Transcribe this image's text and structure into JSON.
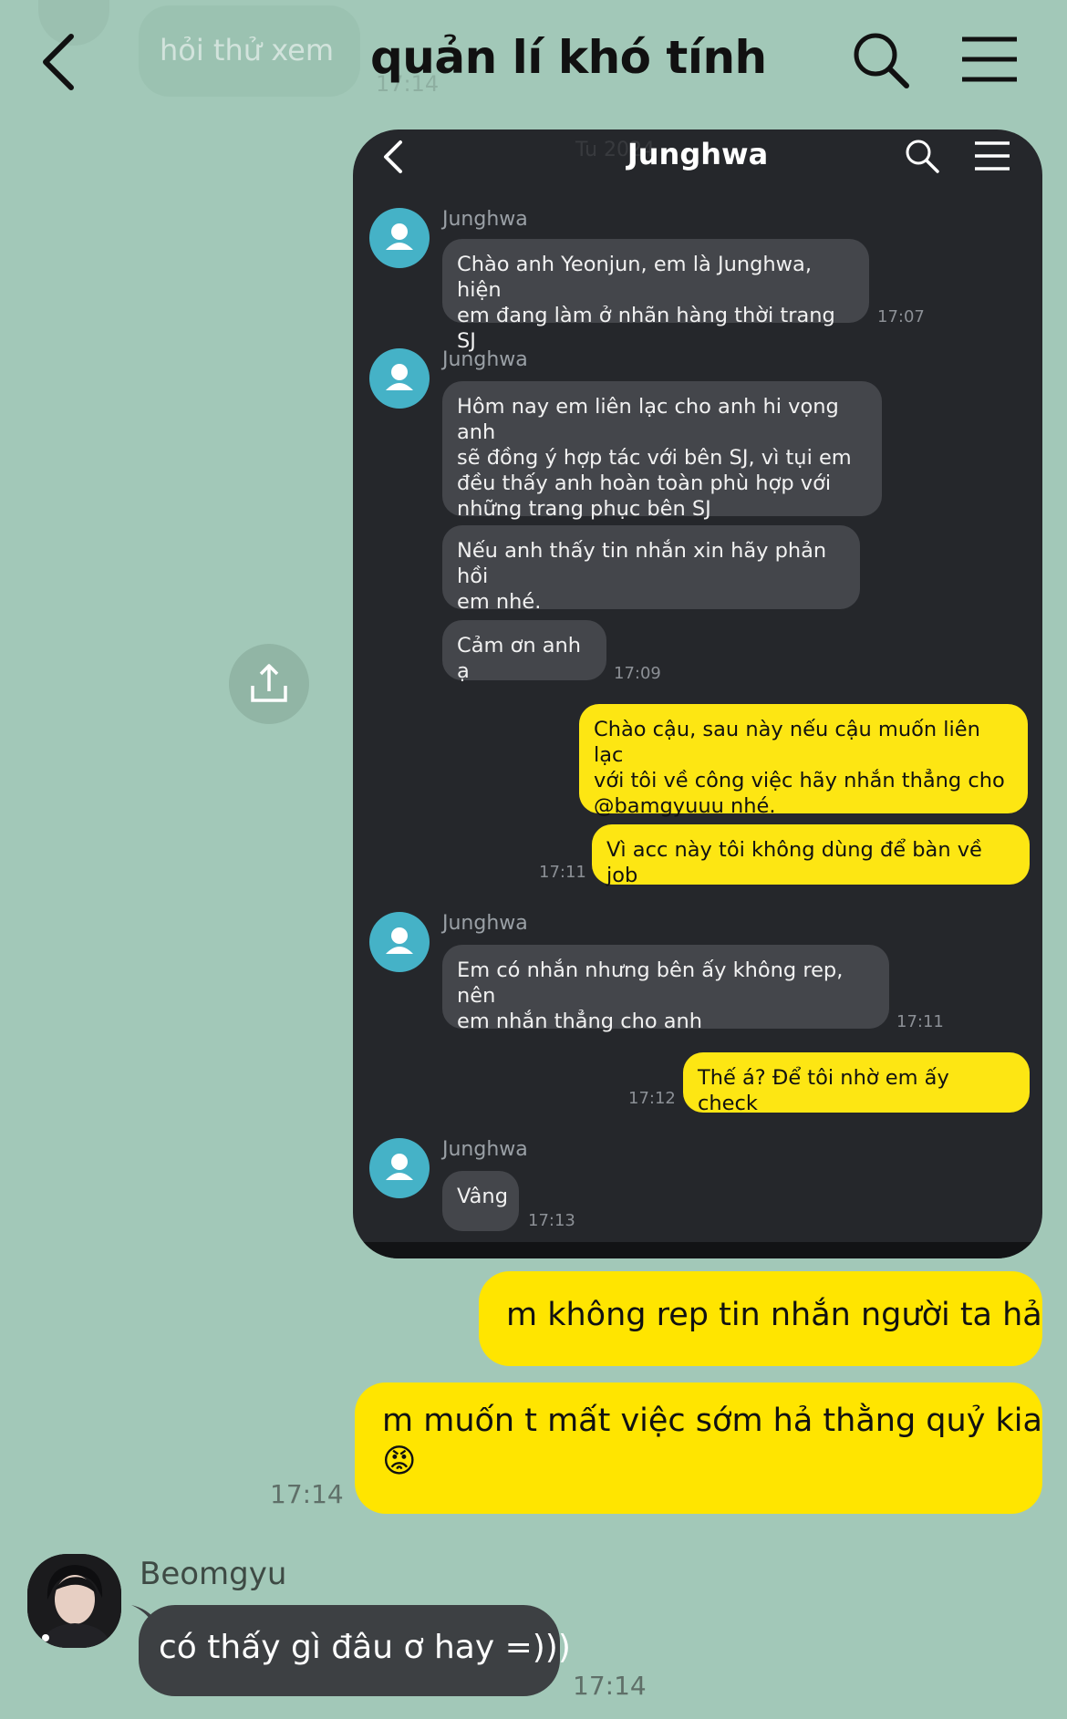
{
  "header": {
    "title": "quản lí khó tính",
    "back_icon": "chevron-left-icon",
    "search_icon": "search-icon",
    "menu_icon": "hamburger-menu-icon",
    "ghost_message": "hỏi thử xem",
    "ghost_time": "17:14"
  },
  "embedded": {
    "title": "Junghwa",
    "date_hint": "Tu                2024",
    "messages": [
      {
        "sender": "Junghwa",
        "lines": [
          "Chào anh Yeonjun, em là Junghwa, hiện",
          "em đang làm ở nhãn hàng thời trang SJ"
        ],
        "time": "17:07"
      },
      {
        "sender": "Junghwa",
        "lines": [
          "Hôm nay em liên lạc cho anh hi vọng anh",
          "sẽ đồng ý hợp tác với bên SJ, vì tụi em",
          "đều thấy anh hoàn toàn phù hợp với",
          "những trang phục bên SJ"
        ]
      },
      {
        "lines": [
          "Nếu anh thấy tin nhắn xin hãy phản hồi",
          "em nhé."
        ]
      },
      {
        "lines": [
          "Cảm ơn anh ạ"
        ],
        "time": "17:09"
      },
      {
        "mine": true,
        "lines": [
          "Chào cậu, sau này nếu cậu muốn liên lạc",
          "với tôi về công việc hãy nhắn thẳng cho",
          "@bamgyuuu nhé."
        ]
      },
      {
        "mine": true,
        "lines": [
          "Vì acc này tôi không dùng để bàn về job"
        ],
        "time": "17:11"
      },
      {
        "sender": "Junghwa",
        "lines": [
          "Em có nhắn nhưng bên ấy không rep, nên",
          "em nhắn thẳng cho anh"
        ],
        "time": "17:11"
      },
      {
        "mine": true,
        "lines": [
          "Thế á? Để tôi nhờ em ấy check"
        ],
        "time": "17:12"
      },
      {
        "sender": "Junghwa",
        "lines": [
          "Vâng"
        ],
        "time": "17:13"
      }
    ]
  },
  "chat": {
    "share_icon": "share-upload-icon",
    "sent": [
      {
        "text": "m không rep tin nhắn người ta hả"
      },
      {
        "text": "m muốn t mất việc sớm hả thằng quỷ kia",
        "emoji": "😡",
        "time": "17:14"
      }
    ],
    "received": {
      "sender": "Beomgyu",
      "text": "có thấy gì đâu ơ hay =)))",
      "time": "17:14"
    }
  },
  "colors": {
    "background": "#a2c8b8",
    "my_bubble": "#ffe500",
    "their_bubble": "#3d4043",
    "embedded_bg": "#25272b",
    "embedded_avatar": "#45b2c7"
  }
}
